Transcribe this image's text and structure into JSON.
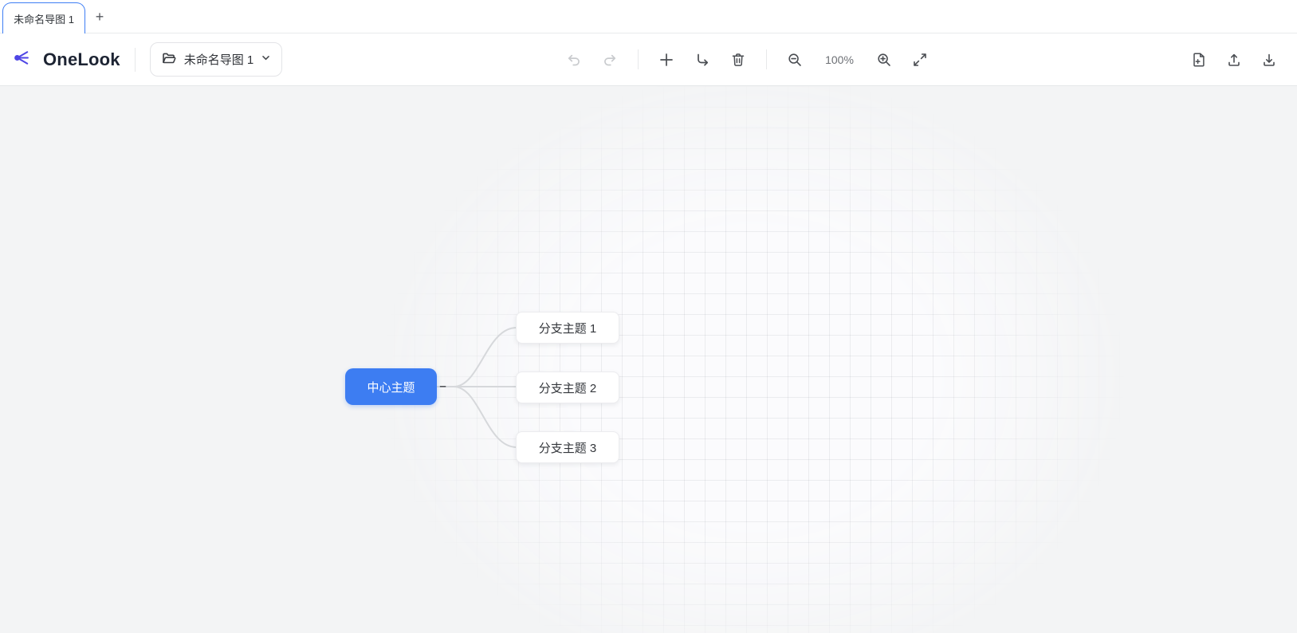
{
  "tab_bar": {
    "active_tab_title": "未命名导图 1",
    "new_tab_button": "+"
  },
  "toolbar": {
    "brand_name": "OneLook",
    "file_selector": {
      "label": "未命名导图 1"
    },
    "zoom_level": "100%"
  },
  "icons": {
    "logo": "mindmap-branches-logo",
    "file_button": "folder-open",
    "file_button_caret": "chevron-down",
    "center": [
      "undo",
      "redo",
      "add-node",
      "add-child-node",
      "trash",
      "zoom-out",
      "zoom-in",
      "expand"
    ],
    "right": [
      "new-document",
      "upload",
      "download"
    ]
  },
  "mindmap": {
    "root": {
      "label": "中心主题",
      "fill": "#3d7df2",
      "text_color": "#ffffff"
    },
    "collapse_indicator": "–",
    "branches": [
      {
        "label": "分支主题 1"
      },
      {
        "label": "分支主题 2"
      },
      {
        "label": "分支主题 3"
      }
    ]
  },
  "colors": {
    "accent_blue": "#3d7df2",
    "brand_indigo": "#4f46e5",
    "tab_active_outline": "#3e7ef5",
    "canvas_bg": "#f3f4f5",
    "connector": "#d6d8db"
  }
}
